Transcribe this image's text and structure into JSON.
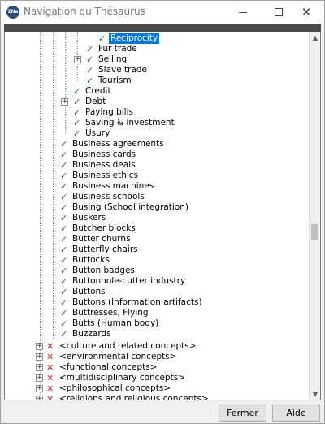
{
  "window": {
    "app_icon_text": "ENe",
    "title": "Navigation du Thésaurus"
  },
  "tree": {
    "items": [
      {
        "label": "Reciprocity",
        "status": "check",
        "selected": true
      },
      {
        "label": "Fur trade",
        "status": "check"
      },
      {
        "label": "Selling",
        "status": "check",
        "expandable": true
      },
      {
        "label": "Slave trade",
        "status": "check"
      },
      {
        "label": "Tourism",
        "status": "check"
      },
      {
        "label": "Credit",
        "status": "check"
      },
      {
        "label": "Debt",
        "status": "check",
        "expandable": true
      },
      {
        "label": "Paying bills",
        "status": "check"
      },
      {
        "label": "Saving & investment",
        "status": "check"
      },
      {
        "label": "Usury",
        "status": "check"
      },
      {
        "label": "Business agreements",
        "status": "check"
      },
      {
        "label": "Business cards",
        "status": "check"
      },
      {
        "label": "Business deals",
        "status": "check"
      },
      {
        "label": "Business ethics",
        "status": "check"
      },
      {
        "label": "Business machines",
        "status": "check"
      },
      {
        "label": "Business schools",
        "status": "check"
      },
      {
        "label": "Busing (School integration)",
        "status": "check"
      },
      {
        "label": "Buskers",
        "status": "check"
      },
      {
        "label": "Butcher blocks",
        "status": "check"
      },
      {
        "label": "Butter churns",
        "status": "check"
      },
      {
        "label": "Butterfly chairs",
        "status": "check"
      },
      {
        "label": "Buttocks",
        "status": "check"
      },
      {
        "label": "Button badges",
        "status": "check"
      },
      {
        "label": "Buttonhole-cutter industry",
        "status": "check"
      },
      {
        "label": "Buttons",
        "status": "check"
      },
      {
        "label": "Buttons (Information artifacts)",
        "status": "check"
      },
      {
        "label": "Buttresses, Flying",
        "status": "check"
      },
      {
        "label": "Butts (Human body)",
        "status": "check"
      },
      {
        "label": "Buzzards",
        "status": "check"
      },
      {
        "label": "<culture and related concepts>",
        "status": "cross",
        "expandable": true
      },
      {
        "label": "<environmental concepts>",
        "status": "cross",
        "expandable": true
      },
      {
        "label": "<functional concepts>",
        "status": "cross",
        "expandable": true
      },
      {
        "label": "<multidisciplinary concepts>",
        "status": "cross",
        "expandable": true
      },
      {
        "label": "<philosophical concepts>",
        "status": "cross",
        "expandable": true
      },
      {
        "label": "<religions and religious concepts>",
        "status": "cross",
        "expandable": true
      }
    ]
  },
  "buttons": {
    "close_label": "Fermer",
    "help_label": "Aide"
  },
  "icons": {
    "expander": "plus-box-icon",
    "check": "check-icon",
    "cross": "cross-icon"
  },
  "colors": {
    "selection": "#0078d7",
    "check": "#1e6b4a",
    "cross": "#e02020"
  }
}
